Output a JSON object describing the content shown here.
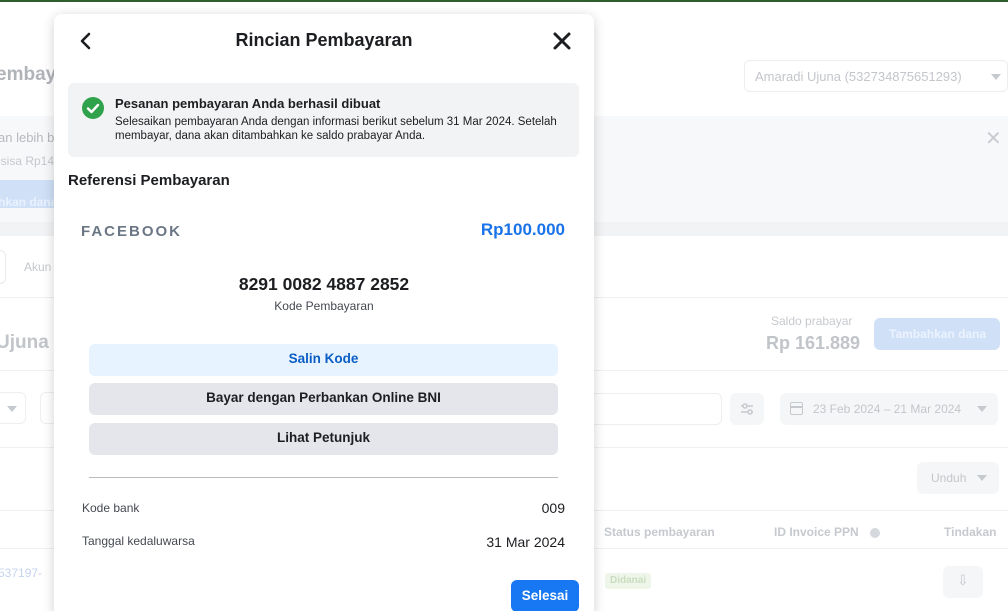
{
  "background": {
    "page_title": "embaya",
    "account_select": "Amaradi Ujuna (532734875651293)",
    "banner": {
      "line1": "an lebih b",
      "line2": "isisa Rp14",
      "button": "hkan dana"
    },
    "tab_label": "Akun",
    "account_name": "Ujuna (",
    "balance": {
      "label": "Saldo prabayar",
      "value": "Rp 161.889",
      "add_button": "Tambahkan dana"
    },
    "date_range": "23 Feb 2024 – 21 Mar 2024",
    "download_button": "Unduh",
    "table": {
      "headers": [
        "Status pembayaran",
        "ID Invoice PPN",
        "Tindakan"
      ],
      "row": {
        "link": "537197-",
        "status": "Didanai",
        "action_icon": "download-icon"
      }
    }
  },
  "modal": {
    "title": "Rincian Pembayaran",
    "back_icon": "chevron-left-icon",
    "close_icon": "close-icon",
    "success": {
      "icon": "check-circle-icon",
      "title": "Pesanan pembayaran Anda berhasil dibuat",
      "body": "Selesaikan pembayaran Anda dengan informasi berikut sebelum 31 Mar 2024. Setelah membayar, dana akan ditambahkan ke saldo prabayar Anda."
    },
    "section_title": "Referensi Pembayaran",
    "brand": "FACEBOOK",
    "amount": "Rp100.000",
    "payment_code": "8291 0082 4887 2852",
    "payment_code_label": "Kode Pembayaran",
    "buttons": {
      "copy": "Salin Kode",
      "bank": "Bayar dengan Perbankan Online BNI",
      "guide": "Lihat Petunjuk"
    },
    "details": [
      {
        "key": "Kode bank",
        "value": "009"
      },
      {
        "key": "Tanggal kedaluwarsa",
        "value": "31 Mar 2024"
      }
    ],
    "done_button": "Selesai"
  },
  "colors": {
    "primary": "#1877f2",
    "amount": "#1a73e8",
    "success": "#31a24c",
    "copy_button_bg": "#e7f3ff",
    "secondary_button_bg": "#e4e6eb"
  }
}
